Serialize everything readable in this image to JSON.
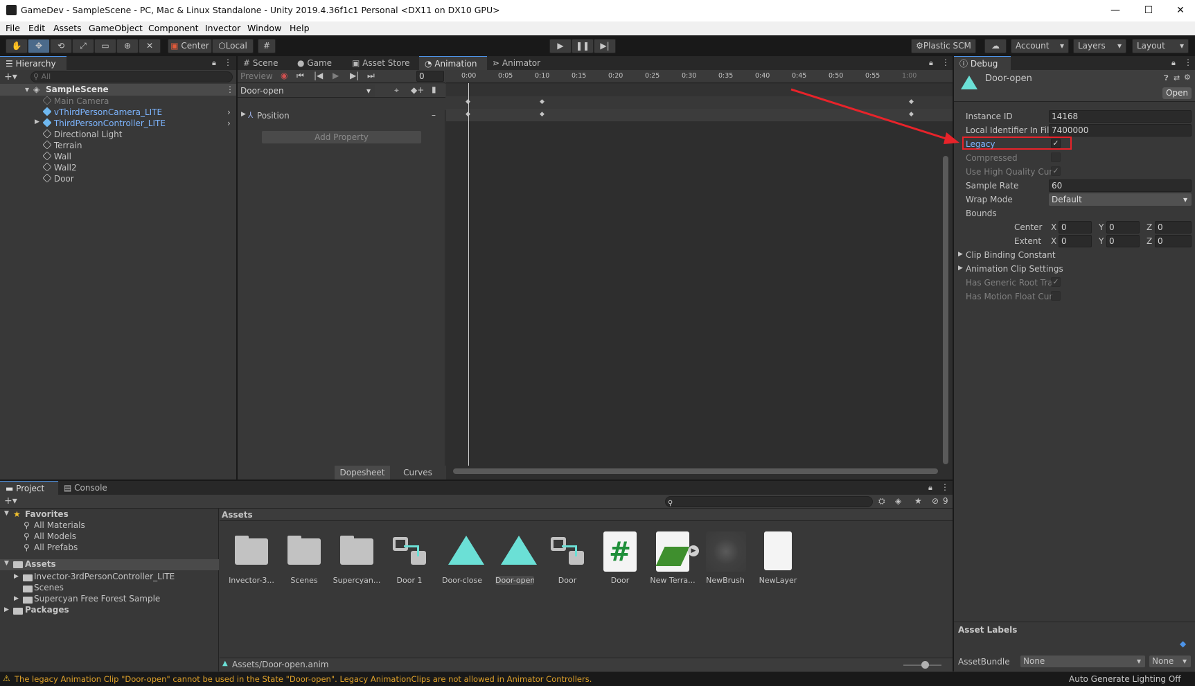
{
  "window": {
    "title": "GameDev - SampleScene - PC, Mac & Linux Standalone - Unity 2019.4.36f1c1 Personal <DX11 on DX10 GPU>",
    "minimize": "—",
    "maximize": "☐",
    "close": "✕"
  },
  "menu": [
    "File",
    "Edit",
    "Assets",
    "GameObject",
    "Component",
    "Invector",
    "Window",
    "Help"
  ],
  "toolbar": {
    "pivot_label": "Center",
    "space_label": "Local",
    "plastic_label": "Plastic SCM",
    "account_label": "Account",
    "layers_label": "Layers",
    "layout_label": "Layout"
  },
  "hierarchy": {
    "tab": "Hierarchy",
    "search_placeholder": "All",
    "scene": "SampleScene",
    "items": [
      {
        "label": "Main Camera",
        "style": "dim"
      },
      {
        "label": "vThirdPersonCamera_LITE",
        "style": "blue"
      },
      {
        "label": "ThirdPersonController_LITE",
        "style": "blue"
      },
      {
        "label": "Directional Light",
        "style": "normal"
      },
      {
        "label": "Terrain",
        "style": "normal"
      },
      {
        "label": "Wall",
        "style": "normal"
      },
      {
        "label": "Wall2",
        "style": "normal"
      },
      {
        "label": "Door",
        "style": "normal"
      }
    ]
  },
  "center_tabs": [
    "Scene",
    "Game",
    "Asset Store",
    "Animation",
    "Animator"
  ],
  "animation": {
    "preview_label": "Preview",
    "frame_value": "0",
    "clip_name": "Door-open",
    "property": "Position",
    "add_property": "Add Property",
    "dopesheet_tab": "Dopesheet",
    "curves_tab": "Curves",
    "ticks": [
      "0:00",
      "0:05",
      "0:10",
      "0:15",
      "0:20",
      "0:25",
      "0:30",
      "0:35",
      "0:40",
      "0:45",
      "0:50",
      "0:55",
      "1:00"
    ]
  },
  "inspector": {
    "tab": "Debug",
    "asset_name": "Door-open",
    "open_button": "Open",
    "instance_id_label": "Instance ID",
    "instance_id": "14168",
    "local_id_label": "Local Identifier In File",
    "local_id": "7400000",
    "legacy_label": "Legacy",
    "legacy_checked": "✓",
    "compressed_label": "Compressed",
    "hq_curve_label": "Use High Quality Cur",
    "hq_curve_checked": "✓",
    "sample_rate_label": "Sample Rate",
    "sample_rate": "60",
    "wrap_mode_label": "Wrap Mode",
    "wrap_mode": "Default",
    "bounds_label": "Bounds",
    "center_label": "Center",
    "extent_label": "Extent",
    "x_label": "X",
    "y_label": "Y",
    "z_label": "Z",
    "center_x": "0",
    "center_y": "0",
    "center_z": "0",
    "extent_x": "0",
    "extent_y": "0",
    "extent_z": "0",
    "clip_binding": "Clip Binding Constant",
    "clip_settings": "Animation Clip Settings",
    "generic_root_label": "Has Generic Root Tra",
    "generic_root_checked": "✓",
    "motion_float_label": "Has Motion Float Cur",
    "asset_labels": "Asset Labels",
    "asset_bundle_label": "AssetBundle",
    "asset_bundle_value": "None",
    "asset_variant_value": "None"
  },
  "project": {
    "tab_project": "Project",
    "tab_console": "Console",
    "hidden_count": "9",
    "favorites": "Favorites",
    "fav_items": [
      "All Materials",
      "All Models",
      "All Prefabs"
    ],
    "assets_root": "Assets",
    "asset_folders": [
      "Invector-3rdPersonController_LITE",
      "Scenes",
      "Supercyan Free Forest Sample"
    ],
    "packages": "Packages",
    "breadcrumb": "Assets",
    "grid": [
      {
        "label": "Invector-3...",
        "kind": "folder"
      },
      {
        "label": "Scenes",
        "kind": "folder"
      },
      {
        "label": "Supercyan...",
        "kind": "folder"
      },
      {
        "label": "Door 1",
        "kind": "controller"
      },
      {
        "label": "Door-close",
        "kind": "anim"
      },
      {
        "label": "Door-open",
        "kind": "anim"
      },
      {
        "label": "Door",
        "kind": "controller"
      },
      {
        "label": "Door",
        "kind": "script"
      },
      {
        "label": "New Terra...",
        "kind": "terrain"
      },
      {
        "label": "NewBrush",
        "kind": "brush"
      },
      {
        "label": "NewLayer",
        "kind": "file"
      }
    ],
    "footer_path": "Assets/Door-open.anim"
  },
  "status": {
    "message": "The legacy Animation Clip \"Door-open\" cannot be used in the State \"Door-open\". Legacy AnimationClips are not allowed in Animator Controllers.",
    "right": "Auto Generate Lighting Off"
  },
  "colors": {
    "accent_blue": "#4d94e8",
    "highlight_red": "#e8232a",
    "warning_yellow": "#f2c12e",
    "anim_cyan": "#6be0d6"
  }
}
